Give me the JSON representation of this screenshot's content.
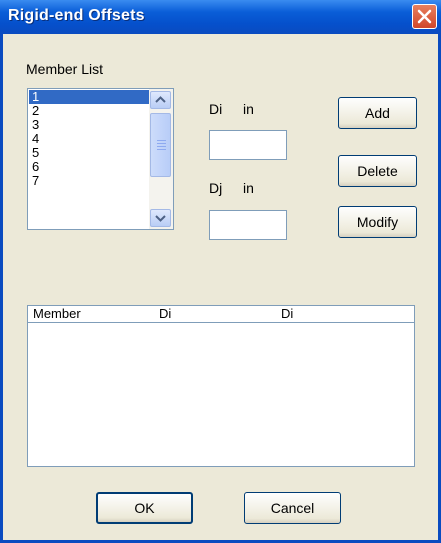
{
  "window": {
    "title": "Rigid-end Offsets"
  },
  "member_list": {
    "label": "Member List",
    "items": [
      "1",
      "2",
      "3",
      "4",
      "5",
      "6",
      "7"
    ],
    "selected": "1"
  },
  "fields": {
    "di_label": "Di",
    "di_unit": "in",
    "dj_label": "Dj",
    "dj_unit": "in"
  },
  "buttons": {
    "add": "Add",
    "delete": "Delete",
    "modify": "Modify",
    "ok": "OK",
    "cancel": "Cancel"
  },
  "table": {
    "columns": [
      "Member",
      "Di",
      "Di"
    ]
  },
  "colors": {
    "titlebar": "#0a5ed8",
    "selection": "#316ac5",
    "dialog_bg": "#ece9d8"
  }
}
